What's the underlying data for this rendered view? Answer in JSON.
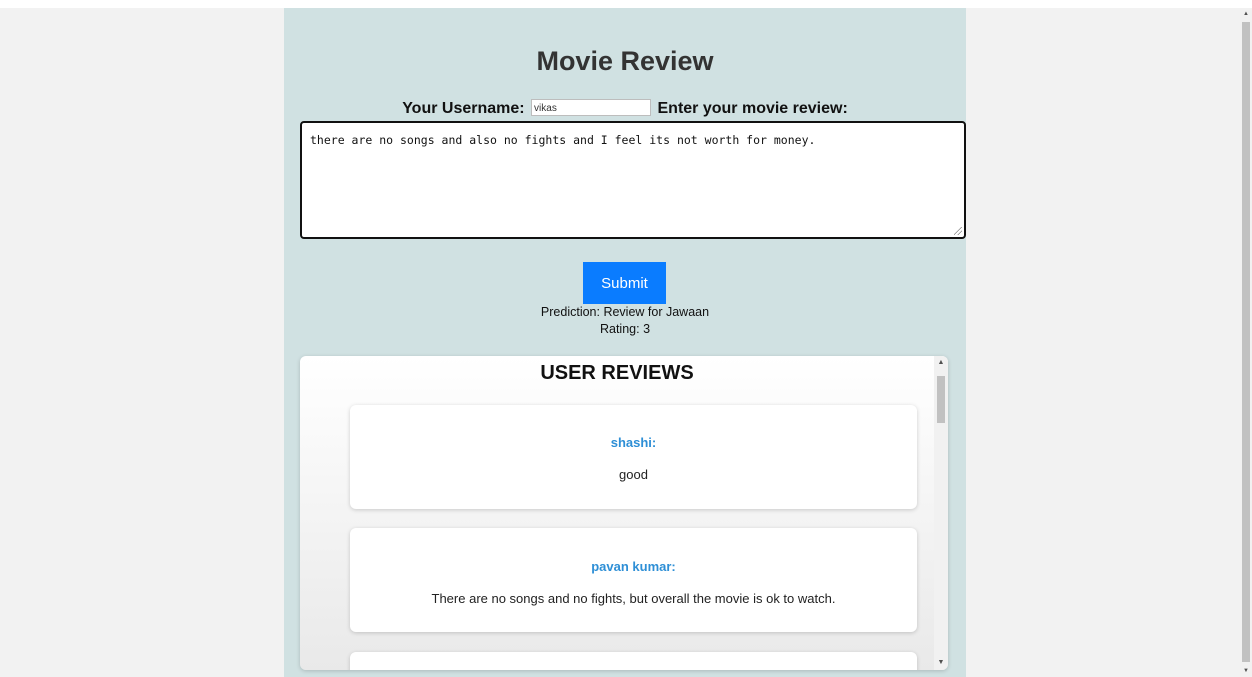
{
  "header": {
    "title": "Movie Review"
  },
  "form": {
    "username_label": "Your Username:",
    "username_value": "vikas",
    "review_label": "Enter your movie review:",
    "review_value": "there are no songs and also no fights and I feel its not worth for money.",
    "submit_label": "Submit"
  },
  "result": {
    "prediction": "Prediction: Review for Jawaan",
    "rating": "Rating: 3"
  },
  "reviews": {
    "title": "USER REVIEWS",
    "items": [
      {
        "user": "shashi:",
        "text": "good"
      },
      {
        "user": "pavan kumar:",
        "text": "There are no songs and no fights, but overall the movie is ok to watch."
      },
      {
        "user": "",
        "text": ""
      }
    ]
  },
  "colors": {
    "page_bg": "#f2f2f2",
    "container_bg": "#d0e1e2",
    "accent": "#0a7cff",
    "username_color": "#2e8fd6"
  },
  "icons": {
    "scroll_up": "triangle-up-icon",
    "scroll_down": "triangle-down-icon"
  }
}
